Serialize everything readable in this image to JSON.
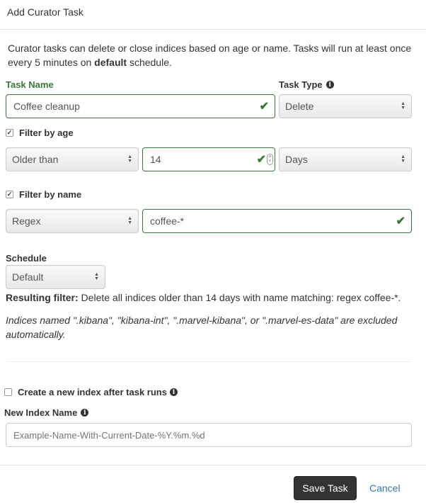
{
  "header": {
    "title": "Add Curator Task"
  },
  "intro": {
    "text_before": "Curator tasks can delete or close indices based on age or name. Tasks will run at least once every 5 minutes on ",
    "bold": "default",
    "text_after": " schedule."
  },
  "task_name": {
    "label": "Task Name",
    "value": "Coffee cleanup",
    "valid": true
  },
  "task_type": {
    "label": "Task Type",
    "value": "Delete",
    "icon": "info-icon"
  },
  "filter_age": {
    "label": "Filter by age",
    "checked": true,
    "condition": "Older than",
    "amount": "14",
    "unit": "Days"
  },
  "filter_name": {
    "label": "Filter by name",
    "checked": true,
    "mode": "Regex",
    "pattern": "coffee-*"
  },
  "schedule": {
    "label": "Schedule",
    "value": "Default"
  },
  "result": {
    "label": "Resulting filter:",
    "text": " Delete all indices older than 14 days with name matching: regex coffee-*."
  },
  "note": "Indices named \".kibana\", \"kibana-int\", \".marvel-kibana\", or \".marvel-es-data\" are excluded automatically.",
  "new_index": {
    "checkbox_label": "Create a new index after task runs",
    "checked": false,
    "name_label": "New Index Name",
    "placeholder": "Example-Name-With-Current-Date-%Y.%m.%d",
    "value": ""
  },
  "footer": {
    "save_label": "Save Task",
    "cancel_label": "Cancel"
  },
  "colors": {
    "valid": "#3c763d",
    "link": "#337ab7",
    "primary_button": "#333333"
  }
}
